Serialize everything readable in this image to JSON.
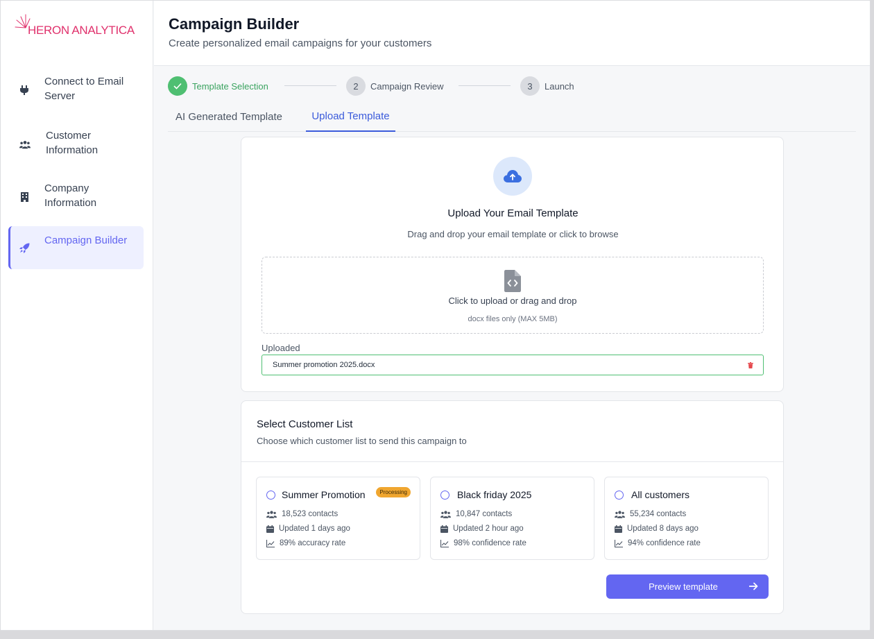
{
  "brand": {
    "name": "HERON ANALYTICA",
    "color": "#e0316c"
  },
  "sidebar": {
    "items": [
      {
        "label": "Connect to Email Server",
        "icon": "plug-icon"
      },
      {
        "label": "Customer Information",
        "icon": "users-icon"
      },
      {
        "label": "Company Information",
        "icon": "building-icon"
      },
      {
        "label": "Campaign Builder",
        "icon": "rocket-icon",
        "active": true
      }
    ]
  },
  "header": {
    "title": "Campaign Builder",
    "subtitle": "Create personalized email campaigns for your customers"
  },
  "stepper": {
    "steps": [
      {
        "number": "",
        "label": "Template Selection",
        "status": "done"
      },
      {
        "number": "2",
        "label": "Campaign Review",
        "status": "pending"
      },
      {
        "number": "3",
        "label": "Launch",
        "status": "pending"
      }
    ]
  },
  "tabs": [
    {
      "label": "AI Generated Template",
      "active": false
    },
    {
      "label": "Upload Template",
      "active": true
    }
  ],
  "upload": {
    "title": "Upload Your Email Template",
    "subtitle": "Drag and drop your email template or click to browse",
    "dropzone_text": "Click to upload or drag and drop",
    "dropzone_hint": "docx files only (MAX 5MB)",
    "uploaded_label": "Uploaded",
    "uploaded_file": "Summer promotion 2025.docx"
  },
  "customer_list": {
    "title": "Select Customer List",
    "subtitle": "Choose which customer list to send this campaign to",
    "lists": [
      {
        "name": "Summer Promotion",
        "badge": "Processing",
        "contacts": "18,523 contacts",
        "updated": "Updated 1 days ago",
        "rate": "89% accuracy rate"
      },
      {
        "name": "Black friday 2025",
        "badge": "",
        "contacts": "10,847 contacts",
        "updated": "Updated 2 hour ago",
        "rate": "98% confidence rate"
      },
      {
        "name": "All customers",
        "badge": "",
        "contacts": "55,234 contacts",
        "updated": "Updated 8 days ago",
        "rate": "94% confidence rate"
      }
    ]
  },
  "actions": {
    "preview_label": "Preview template"
  },
  "colors": {
    "accent": "#6366f1",
    "success": "#4fbf72",
    "tab_active": "#3b5bdb",
    "badge": "#f0a62f"
  }
}
